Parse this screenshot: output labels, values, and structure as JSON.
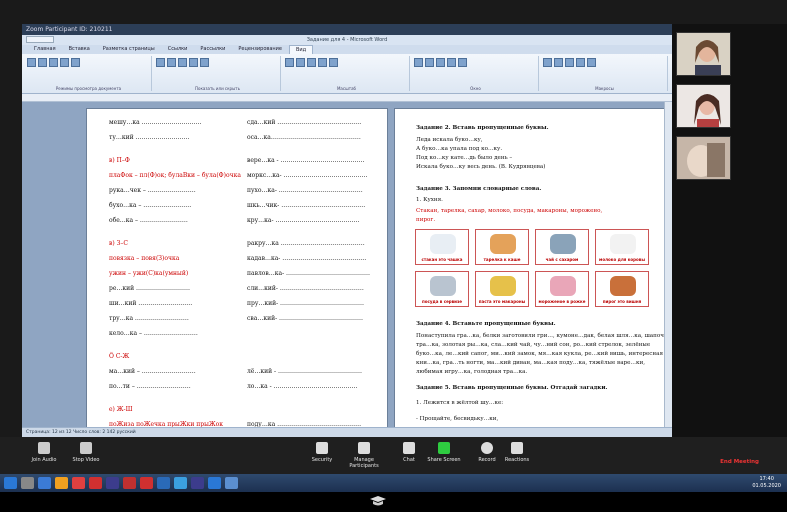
{
  "zoom": {
    "title": "Zoom Participant ID: 210211",
    "end_meeting": "End Meeting",
    "controls": [
      {
        "label": "Join Audio",
        "icon": "headphones-icon"
      },
      {
        "label": "Stop Video",
        "icon": "camera-icon"
      },
      {
        "label": "Security",
        "icon": "shield-icon"
      },
      {
        "label": "Manage Participants",
        "icon": "participants-icon"
      },
      {
        "label": "Chat",
        "icon": "chat-icon"
      },
      {
        "label": "Share Screen",
        "icon": "share-screen-icon"
      },
      {
        "label": "Record",
        "icon": "record-icon"
      },
      {
        "label": "Reactions",
        "icon": "reactions-icon"
      }
    ]
  },
  "word": {
    "window_title": "Задание для 4 - Microsoft Word",
    "tabs": [
      "Главная",
      "Вставка",
      "Разметка страницы",
      "Ссылки",
      "Рассылки",
      "Рецензирование",
      "Вид"
    ],
    "active_tab": "Вид",
    "ribbon_groups": [
      "Режимы просмотра документа",
      "Показать или скрыть",
      "Масштаб",
      "Окно",
      "Макросы"
    ],
    "status": "Страница: 12 из 12   Число слов: 2 142   русский"
  },
  "page1": {
    "lines": [
      {
        "l": "мешу…ка …………………………",
        "r": "сда…кий ……………………………………"
      },
      {
        "l": "ту…кий ………………………",
        "r": "оса…ка………………………………………"
      },
      {
        "l": "в) П–Ф",
        "r": "вере…ка - ……………………………………"
      },
      {
        "l": "плаФок – пл(Ф)ок; булаВки – була(Ф)очка",
        "r": "моркс…ка- ……………………………………"
      },
      {
        "l": "рука…чек – ……………………",
        "r": "пухо…ка- ……………………………………"
      },
      {
        "l": "бухо…ка – ……………………",
        "r": "шкь…чик- ……………………………………"
      },
      {
        "l": "обе…ка – ……………………",
        "r": "кру…ка- ……………………………………"
      },
      {
        "l": "в) З–С",
        "r": "ракру…ка ……………………………………"
      },
      {
        "l": "повязка – повя(З)очка",
        "r": "кадав…ка- ……………………………………"
      },
      {
        "l": "ужин – ужи(С)ка(умный)",
        "r": "павлов…ка- ……………………………………"
      },
      {
        "l": "ре…кий ………………………",
        "r": "сли…кий- ……………………………………"
      },
      {
        "l": "ши…кий ………………………",
        "r": "пру…кий- ……………………………………"
      },
      {
        "l": "тру…ка ………………………",
        "r": "сва…кий- ……………………………………"
      },
      {
        "l": "кело…ка – ………………………",
        "r": ""
      },
      {
        "l": "Ö С-Ж",
        "r": ""
      },
      {
        "l": "ма…кий – ………………………",
        "r": "лё…кий - ……………………………………"
      },
      {
        "l": "по…ти – ………………………",
        "r": "ло…ка - ……………………………………"
      },
      {
        "l": "e) Ж-Ш",
        "r": ""
      },
      {
        "l": "поЖиза поЖечка прыЖки прыЖок",
        "r": "поду…ка ……………………………………"
      }
    ]
  },
  "page2": {
    "t2_title": "Задание 2. Вставь пропущенные буквы.",
    "t2_lines": [
      "Леда искала буко…ку,",
      "А буко…ка упала под ко…ку.",
      "Под ко…ку кате…дь было день –",
      "Искала буко…ку весь день. (В. Кудрявцева)"
    ],
    "t3_title": "Задание 3. Запомни словарные слова.",
    "t3_sub": "1.     Кухня.",
    "t3_words": "Стакан, тарелка, сахар, молоко, посуда, макароны, морожено,",
    "t3_words2": "пирог.",
    "images": [
      "стакан это чашка",
      "тарелка к каше",
      "чай с сахаром",
      "молоко для коровы",
      "посуда в сервизе",
      "паста это макароны",
      "мороженое в рожке",
      "пирог это вишня"
    ],
    "t4_title": "Задание 4. Вставьте пропущенные буквы.",
    "t4_lines": [
      "Понаступила гра…ка, белки заготовили гри…, кумоне…дак, белая шля…ка, шапочные",
      "тра…ка, золотая ры…ка, сла…кий чай, чу…ний сон, ро…кий стрелок, зелёные",
      "буко…ка, ле…кий сапог, ми…кий замок, мя…кая кукла, ре…кий вишь, интересная",
      "кни…ка, гра…ть ногти, ма…кий диван, ма…кая поду…ка, тяжёлые варе…ки,",
      "любимая игру…ка, голодная тра…ка."
    ],
    "t5_title": "Задание 5. Вставь пропущенные буквы. Отгадай загадки.",
    "t5_lines": [
      "1. Лежится в жёлтой шу…ке:",
      "- Прощайте, бесвидьку…ки,"
    ]
  },
  "clock": {
    "time": "17:40",
    "date": "01.05.2020"
  }
}
